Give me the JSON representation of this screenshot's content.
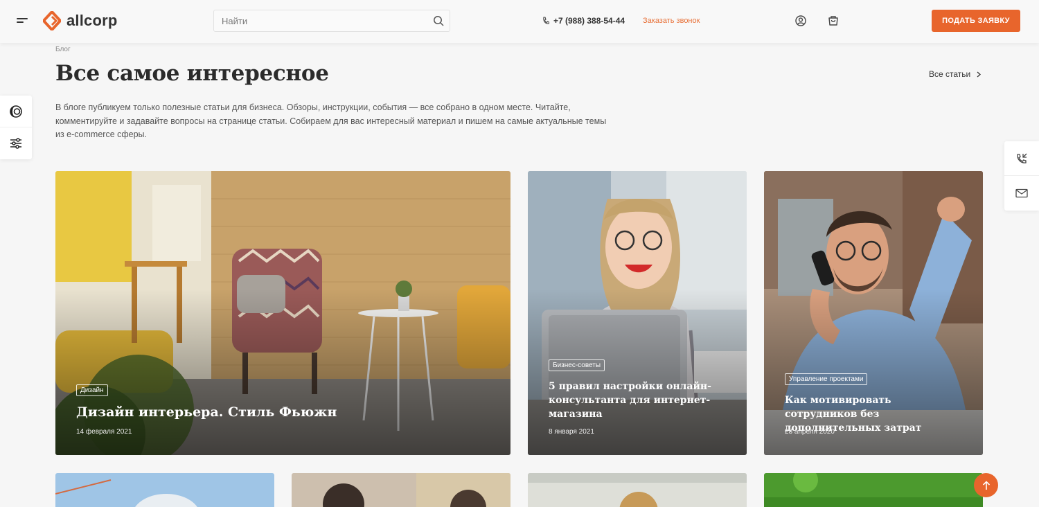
{
  "header": {
    "logo_text": "allcorp",
    "search_placeholder": "Найти",
    "phone": "+7 (988) 388-54-44",
    "callback_label": "Заказать звонок",
    "cta_label": "ПОДАТЬ ЗАЯВКУ",
    "accent_color": "#e8652c"
  },
  "breadcrumb": "Блог",
  "page_title": "Все самое интересное",
  "all_articles_label": "Все статьи",
  "intro": "В блоге публикуем только полезные статьи для бизнеса. Обзоры, инструкции, события — все собрано в одном месте. Читайте, комментируйте и задавайте вопросы на странице статьи. Собираем для вас интересный материал и пишем на самые актуальные темы из e-commerce сферы.",
  "cards": [
    {
      "tag": "Дизайн",
      "title": "Дизайн интерьера. Стиль Фьюжн",
      "date": "14 февраля 2021"
    },
    {
      "tag": "Бизнес-советы",
      "title": "5 правил настройки онлайн-консультанта для интернет-магазина",
      "date": "8 января 2021"
    },
    {
      "tag": "Управление проектами",
      "title": "Как мотивировать сотрудников без дополнительных затрат",
      "date": "28 апреля 2020"
    }
  ],
  "icons": {
    "menu": "burger-menu-icon",
    "search": "search-icon",
    "phone": "phone-icon",
    "account": "user-icon",
    "cart": "cart-icon",
    "theme": "theme-toggle-icon",
    "filters": "settings-sliders-icon",
    "call": "phone-call-icon",
    "mail": "mail-icon",
    "up": "arrow-up-icon"
  }
}
